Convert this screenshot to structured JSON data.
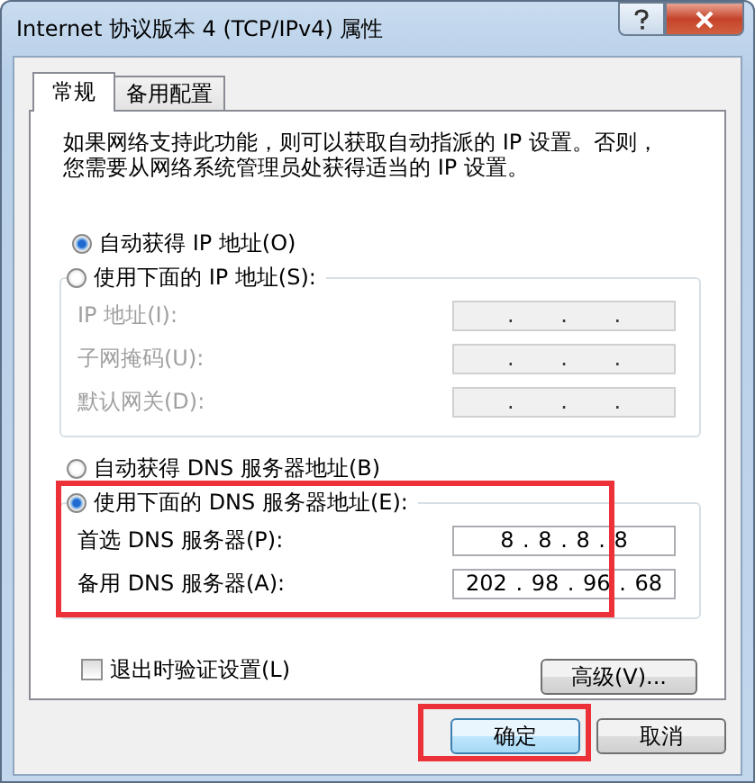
{
  "window": {
    "title": "Internet 协议版本 4 (TCP/IPv4) 属性"
  },
  "tabs": [
    {
      "label": "常规",
      "selected": true
    },
    {
      "label": "备用配置",
      "selected": false
    }
  ],
  "description": "如果网络支持此功能，则可以获取自动指派的 IP 设置。否则，您需要从网络系统管理员处获得适当的 IP 设置。",
  "ip_auto": {
    "label": "自动获得 IP 地址(O)",
    "selected": true
  },
  "ip_manual": {
    "label": "使用下面的 IP 地址(S):",
    "selected": false,
    "fields": [
      {
        "label": "IP 地址(I):",
        "value": ". . .",
        "disabled": true
      },
      {
        "label": "子网掩码(U):",
        "value": ". . .",
        "disabled": true
      },
      {
        "label": "默认网关(D):",
        "value": ". . .",
        "disabled": true
      }
    ]
  },
  "dns_auto": {
    "label": "自动获得 DNS 服务器地址(B)",
    "selected": false
  },
  "dns_manual": {
    "label": "使用下面的 DNS 服务器地址(E):",
    "selected": true,
    "highlighted": true,
    "fields": [
      {
        "label": "首选 DNS 服务器(P):",
        "value": "8 . 8 . 8 . 8",
        "disabled": false
      },
      {
        "label": "备用 DNS 服务器(A):",
        "value": "202 . 98 . 96 . 68",
        "disabled": false
      }
    ]
  },
  "validate": {
    "label": "退出时验证设置(L)",
    "checked": false
  },
  "advanced_button": "高级(V)...",
  "ok_button": {
    "label": "确定",
    "highlighted": true
  },
  "cancel_button": "取消"
}
